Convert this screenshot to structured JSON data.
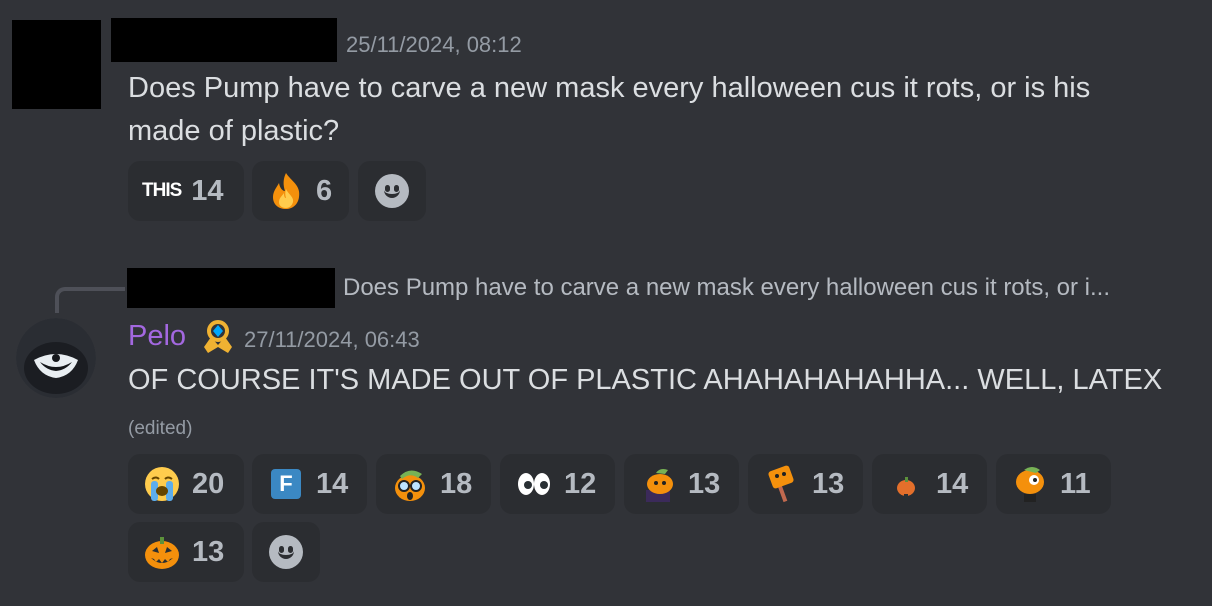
{
  "message1": {
    "timestamp": "25/11/2024, 08:12",
    "text_line1": "Does Pump have to carve a new mask every halloween cus it rots, or is his",
    "text_line2": "made of plastic?",
    "reactions": [
      {
        "emoji": "this-text-emoji",
        "label": "THIS",
        "count": "14"
      },
      {
        "emoji": "fire-emoji",
        "count": "6"
      }
    ]
  },
  "message2": {
    "reply_preview": "Does Pump have to carve a new mask every halloween cus it rots, or i...",
    "username": "Pelo",
    "timestamp": "27/11/2024, 06:43",
    "text": "OF COURSE IT'S MADE OUT OF PLASTIC AHAHAHAHAHHA... WELL, LATEX",
    "edited": "(edited)",
    "reactions": [
      {
        "emoji": "loudly-crying-emoji",
        "count": "20"
      },
      {
        "emoji": "f-emoji",
        "label": "F",
        "count": "14"
      },
      {
        "emoji": "pumpkin-glasses-emoji",
        "count": "18"
      },
      {
        "emoji": "eyes-emoji",
        "count": "12"
      },
      {
        "emoji": "pumpkin-suit-emoji",
        "count": "13"
      },
      {
        "emoji": "pumpkin-sign-emoji",
        "count": "13"
      },
      {
        "emoji": "tiny-pumpkin-emoji",
        "count": "14"
      },
      {
        "emoji": "pumpkin-character-emoji",
        "count": "11"
      },
      {
        "emoji": "jack-o-lantern-emoji",
        "count": "13"
      }
    ]
  },
  "colors": {
    "background": "#313338",
    "reaction_bg": "#2b2d31",
    "username": "#a368e0",
    "muted": "#949ba4"
  }
}
